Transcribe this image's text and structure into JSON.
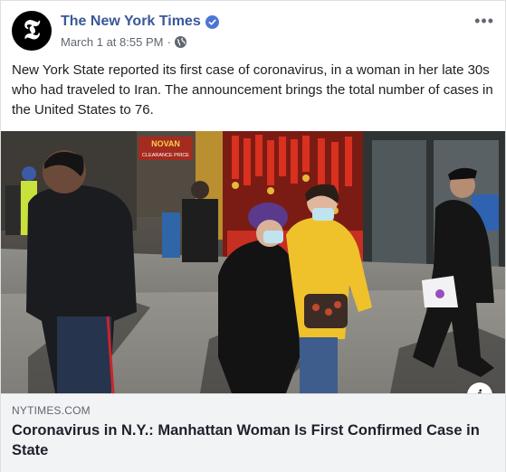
{
  "post": {
    "page_name": "The New York Times",
    "timestamp": "March 1 at 8:55 PM",
    "separator": "·",
    "more_label": "•••",
    "body_text": "New York State reported its first case of coronavirus, in a woman in her late 30s who had traveled to Iran. The announcement brings the total number of cases in the United States to 76.",
    "avatar_glyph": "𝕿",
    "icons": {
      "verified": "verified-badge-icon",
      "audience": "globe-icon",
      "info": "info-icon"
    }
  },
  "image": {
    "storefront_sign": "NOVAN",
    "storefront_subsign": "CLEARANCE PRICE"
  },
  "link_preview": {
    "domain": "NYTIMES.COM",
    "title": "Coronavirus in N.Y.: Manhattan Woman Is First Confirmed Case in State",
    "info_glyph": "i"
  },
  "colors": {
    "link_blue": "#385898",
    "verified_blue": "#4a76d8",
    "preview_bg": "#f2f3f5",
    "meta_gray": "#606770"
  }
}
